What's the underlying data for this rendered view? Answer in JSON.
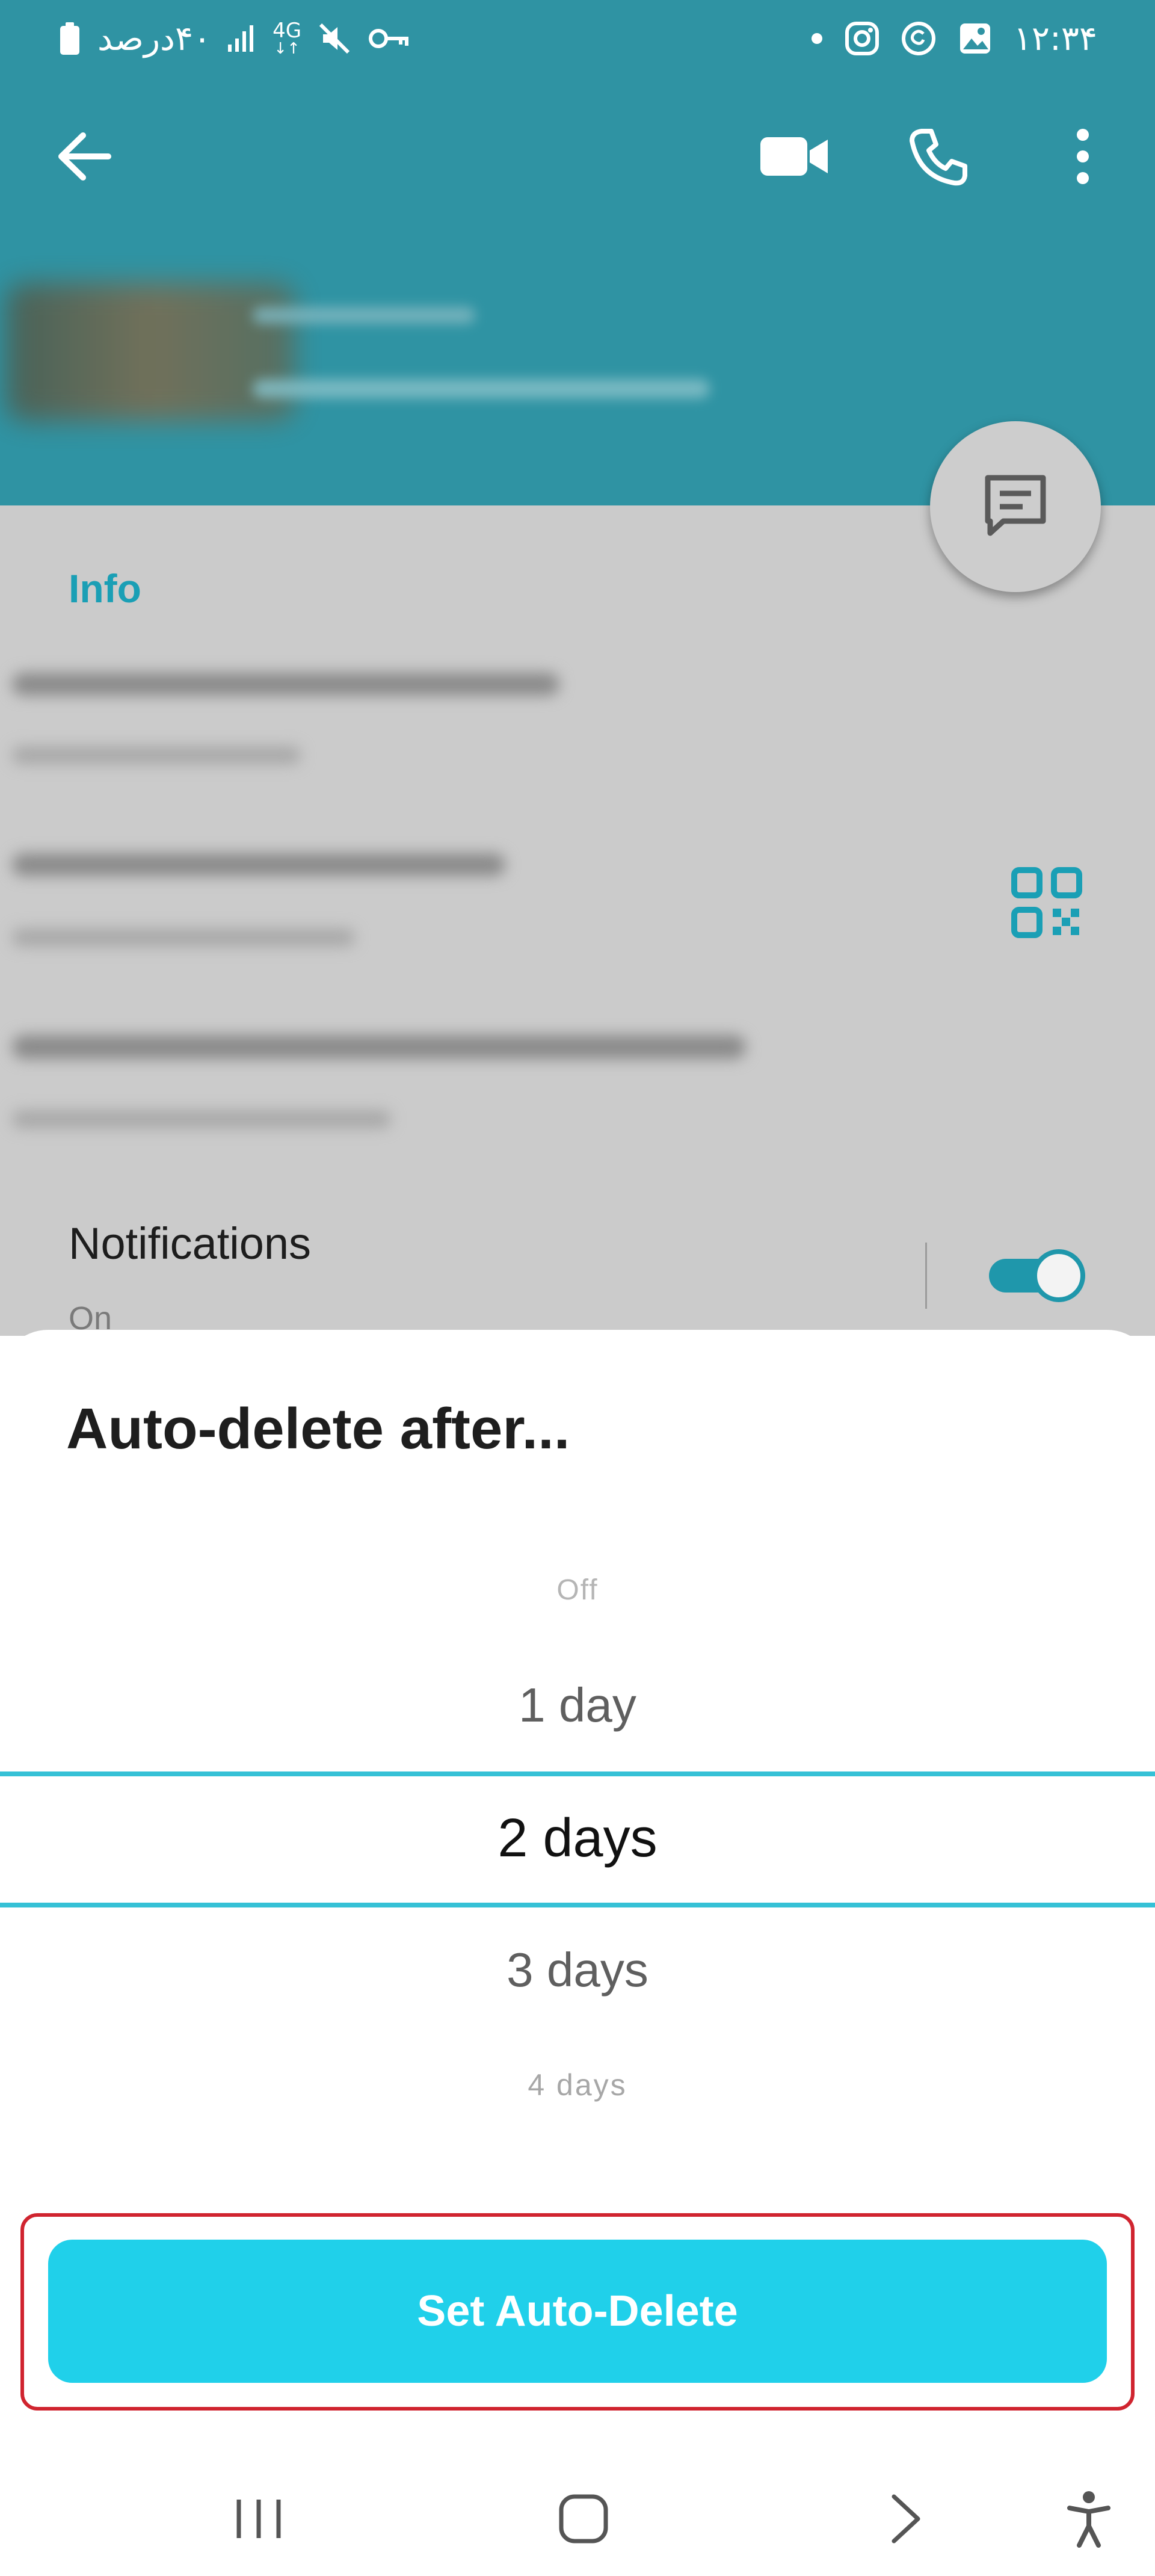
{
  "status_bar": {
    "battery_text": "۴۰درصد",
    "network_type": "4G",
    "time": "۱۲:۳۴",
    "icons": [
      "battery-icon",
      "signal-icon",
      "network-4g-icon",
      "mute-icon",
      "vpn-key-icon",
      "dot-icon",
      "instagram-icon",
      "threads-icon",
      "gallery-icon"
    ]
  },
  "toolbar": {
    "back_icon": "arrow-left-icon",
    "video_icon": "video-call-icon",
    "call_icon": "phone-icon",
    "more_icon": "more-vertical-icon"
  },
  "fab": {
    "icon": "message-icon"
  },
  "info": {
    "heading": "Info",
    "qr_icon": "qr-code-icon"
  },
  "notifications": {
    "title": "Notifications",
    "status": "On",
    "toggle_on": true
  },
  "sheet": {
    "title": "Auto-delete after...",
    "options": [
      "Off",
      "1 day",
      "2 days",
      "3 days",
      "4 days"
    ],
    "selected": "2 days",
    "button_label": "Set Auto-Delete"
  },
  "nav": {
    "recents_icon": "recents-icon",
    "home_icon": "home-icon",
    "back_icon": "nav-back-icon",
    "accessibility_icon": "accessibility-icon"
  },
  "colors": {
    "header": "#2f93a3",
    "accent": "#1a9fb5",
    "button": "#20d0ea",
    "highlight": "#d0242f"
  }
}
